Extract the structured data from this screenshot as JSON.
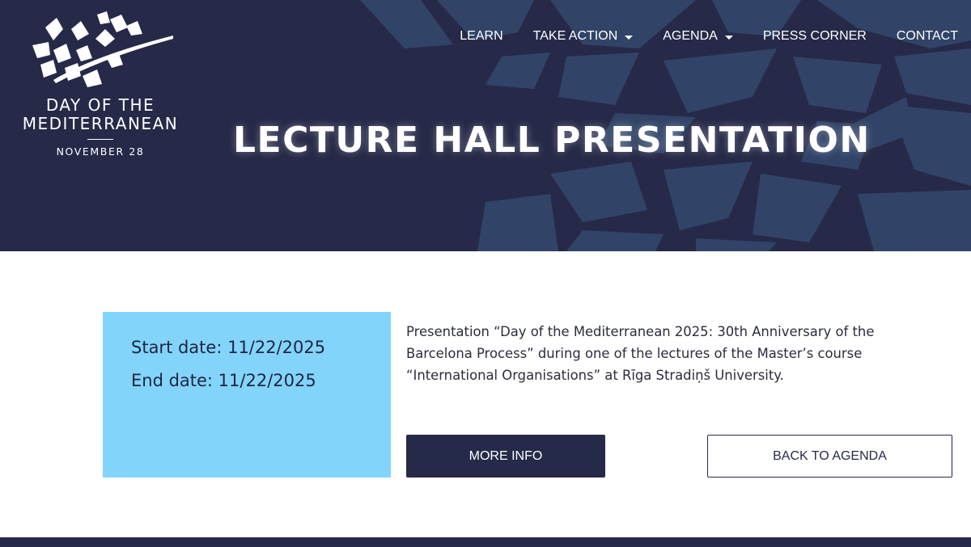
{
  "colors": {
    "brand_navy": "#262a48",
    "accent_blue": "#82d4fb",
    "pattern_blue": "#33496e"
  },
  "brand": {
    "line1": "DAY OF THE",
    "line2": "MEDITERRANEAN",
    "date": "NOVEMBER 28",
    "logo_icon": "olive-branch-icon"
  },
  "nav": {
    "items": [
      {
        "label": "LEARN",
        "has_dropdown": false
      },
      {
        "label": "TAKE ACTION",
        "has_dropdown": true
      },
      {
        "label": "AGENDA",
        "has_dropdown": true
      },
      {
        "label": "PRESS CORNER",
        "has_dropdown": false
      },
      {
        "label": "CONTACT",
        "has_dropdown": false
      }
    ]
  },
  "page": {
    "title": "LECTURE HALL PRESENTATION"
  },
  "event": {
    "start": "Start date: 11/22/2025",
    "end": "End date: 11/22/2025",
    "description": "Presentation “Day of the Mediterranean 2025: 30th Anniversary of the Barcelona Process” during one of the lectures of the Master’s course “International Organisations” at Rīga Stradiņš University."
  },
  "buttons": {
    "more_info": "MORE INFO",
    "back": "BACK TO AGENDA"
  }
}
